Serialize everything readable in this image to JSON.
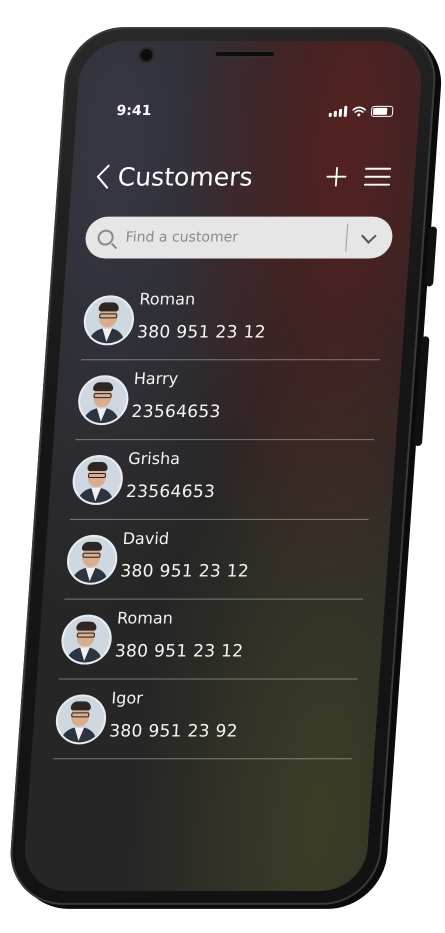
{
  "status_bar": {
    "time": "9:41",
    "icons": [
      "signal-icon",
      "wifi-icon",
      "battery-icon"
    ]
  },
  "header": {
    "back_icon": "chevron-left-icon",
    "title": "Customers",
    "add_icon": "plus-icon",
    "menu_icon": "hamburger-menu-icon"
  },
  "search": {
    "placeholder": "Find a customer",
    "value": "",
    "dropdown_icon": "chevron-down-icon"
  },
  "customers": [
    {
      "name": "Roman",
      "phone": "380 951 23 12"
    },
    {
      "name": "Harry",
      "phone": "23564653"
    },
    {
      "name": "Grisha",
      "phone": "23564653"
    },
    {
      "name": "David",
      "phone": "380 951 23 12"
    },
    {
      "name": "Roman",
      "phone": "380 951 23 12"
    },
    {
      "name": "Igor",
      "phone": "380 951 23 92"
    }
  ],
  "colors": {
    "background": "#262626",
    "text": "#f2f2f2",
    "search_bg": "#e6e6e6",
    "accent_red": "#6e1e1e"
  }
}
